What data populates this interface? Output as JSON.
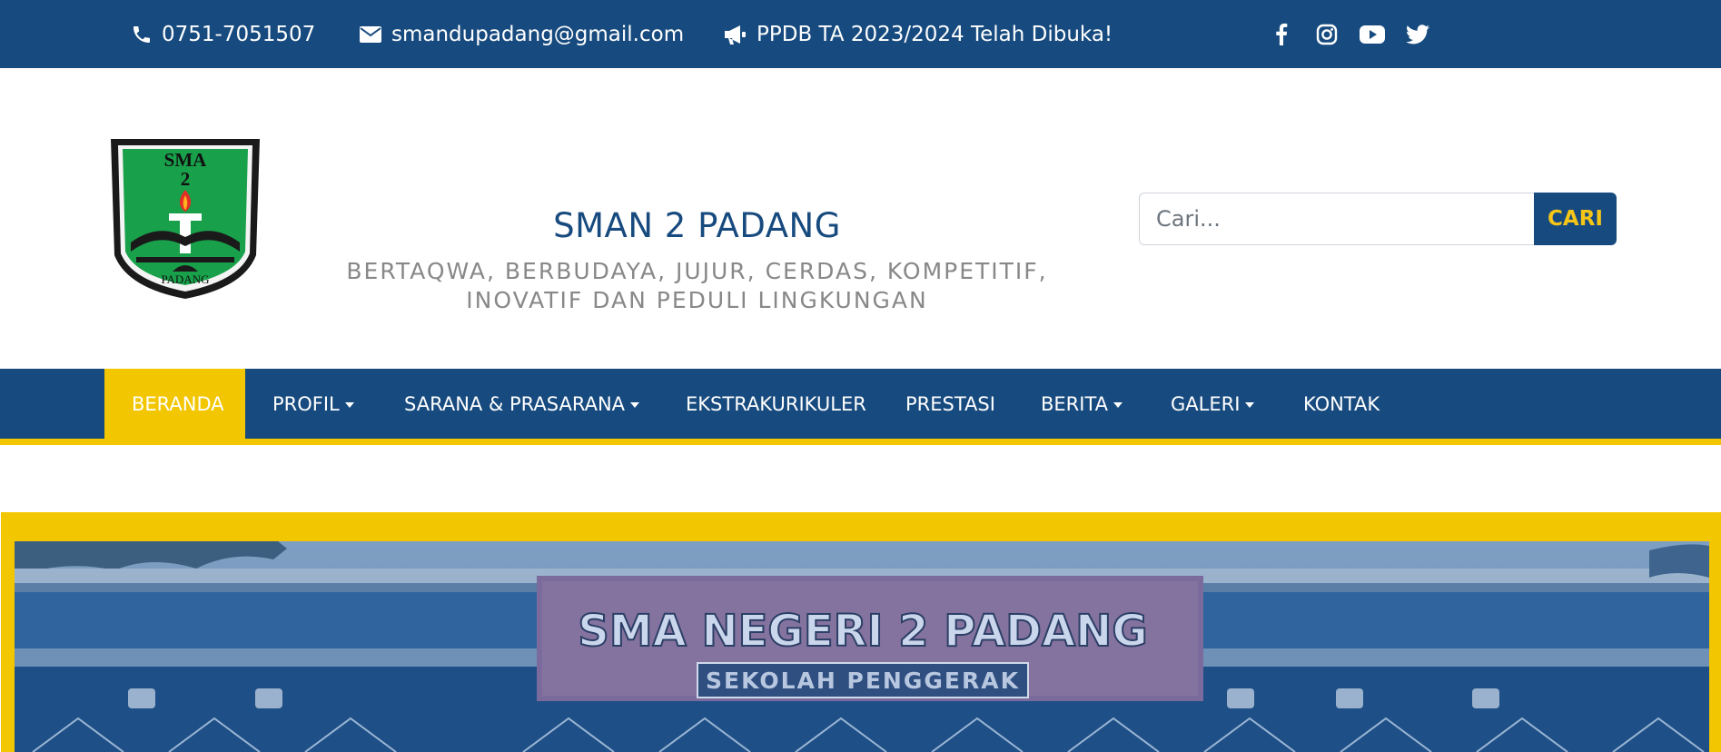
{
  "topbar": {
    "phone": "0751-7051507",
    "email": "smandupadang@gmail.com",
    "announcement": "PPDB TA 2023/2024 Telah Dibuka!",
    "social_icons": [
      "facebook-icon",
      "instagram-icon",
      "youtube-icon",
      "twitter-icon"
    ]
  },
  "header": {
    "logo_text": {
      "top": "SMA",
      "number": "2",
      "bottom": "PADANG"
    },
    "title": "SMAN 2 PADANG",
    "motto_line1": "BERTAQWA, BERBUDAYA, JUJUR, CERDAS, KOMPETITIF,",
    "motto_line2": "INOVATIF DAN PEDULI LINGKUNGAN"
  },
  "search": {
    "placeholder": "Cari...",
    "button_label": "CARI"
  },
  "nav": {
    "items": [
      {
        "label": "BERANDA",
        "active": true,
        "dropdown": false
      },
      {
        "label": "PROFIL",
        "active": false,
        "dropdown": true
      },
      {
        "label": "SARANA & PRASARANA",
        "active": false,
        "dropdown": true
      },
      {
        "label": "EKSTRAKURIKULER",
        "active": false,
        "dropdown": false
      },
      {
        "label": "PRESTASI",
        "active": false,
        "dropdown": false
      },
      {
        "label": "BERITA",
        "active": false,
        "dropdown": true
      },
      {
        "label": "GALERI",
        "active": false,
        "dropdown": true
      },
      {
        "label": "KONTAK",
        "active": false,
        "dropdown": false
      }
    ]
  },
  "hero": {
    "building_sign": "SMA NEGERI 2 PADANG",
    "building_subsign": "SEKOLAH PENGGERAK"
  },
  "colors": {
    "primary_blue": "#174a7e",
    "accent_yellow": "#f2c600",
    "search_btn_text": "#f5c518",
    "motto_gray": "#888888"
  }
}
